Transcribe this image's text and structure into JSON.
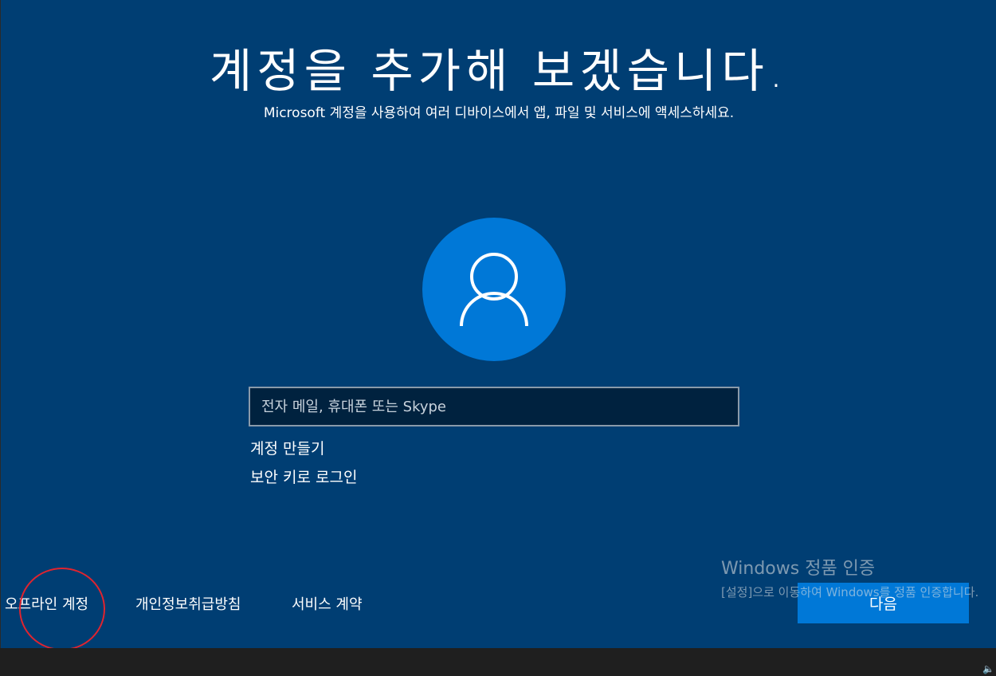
{
  "heading": "계정을 추가해 보겠습니다.",
  "subheading": "Microsoft 계정을 사용하여 여러 디바이스에서 앱, 파일 및 서비스에 액세스하세요.",
  "avatar": {
    "icon": "person-icon",
    "color": "#0078d7"
  },
  "email_input": {
    "placeholder": "전자 메일, 휴대폰 또는 Skype",
    "value": ""
  },
  "links": {
    "create_account": "계정 만들기",
    "security_key": "보안 키로 로그인"
  },
  "footer": {
    "offline_account": "오프라인 계정",
    "privacy": "개인정보취급방침",
    "terms": "서비스 계약"
  },
  "next_button": "다음",
  "watermark": {
    "title": "Windows 정품 인증",
    "body": "[설정]으로 이동하여 Windows를 정품 인증합니다."
  },
  "colors": {
    "background": "#003e73",
    "accent": "#0078d7",
    "highlight_circle": "#e0242f"
  }
}
